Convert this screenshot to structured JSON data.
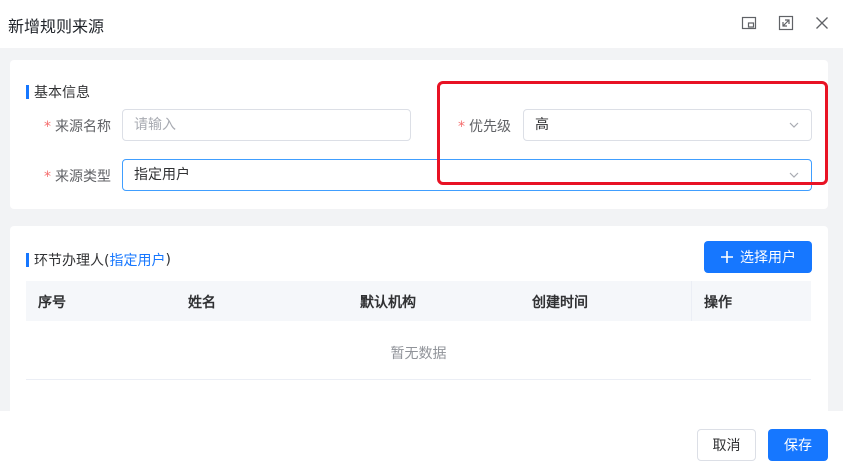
{
  "dialog": {
    "title": "新增规则来源"
  },
  "basic_info": {
    "section_title": "基本信息",
    "source_name": {
      "label": "来源名称",
      "required": "*",
      "placeholder": "请输入",
      "value": ""
    },
    "priority": {
      "label": "优先级",
      "required": "*",
      "value": "高"
    },
    "source_type": {
      "label": "来源类型",
      "required": "*",
      "value": "指定用户"
    }
  },
  "handlers": {
    "section_title_prefix": "环节办理人(",
    "section_title_link": "指定用户",
    "section_title_suffix": ")",
    "select_user_button": "选择用户",
    "table": {
      "columns": [
        "序号",
        "姓名",
        "默认机构",
        "创建时间",
        "操作"
      ],
      "empty_text": "暂无数据"
    }
  },
  "footer": {
    "cancel_label": "取消",
    "save_label": "保存"
  },
  "colors": {
    "primary": "#1677ff",
    "required": "#f56c6c",
    "highlight_box": "#e81224"
  },
  "icons": {
    "header_buttons": [
      "restore-window-icon",
      "fullscreen-icon",
      "close-icon"
    ],
    "select_chevron": "chevron-down-icon",
    "add_icon": "plus-icon"
  }
}
